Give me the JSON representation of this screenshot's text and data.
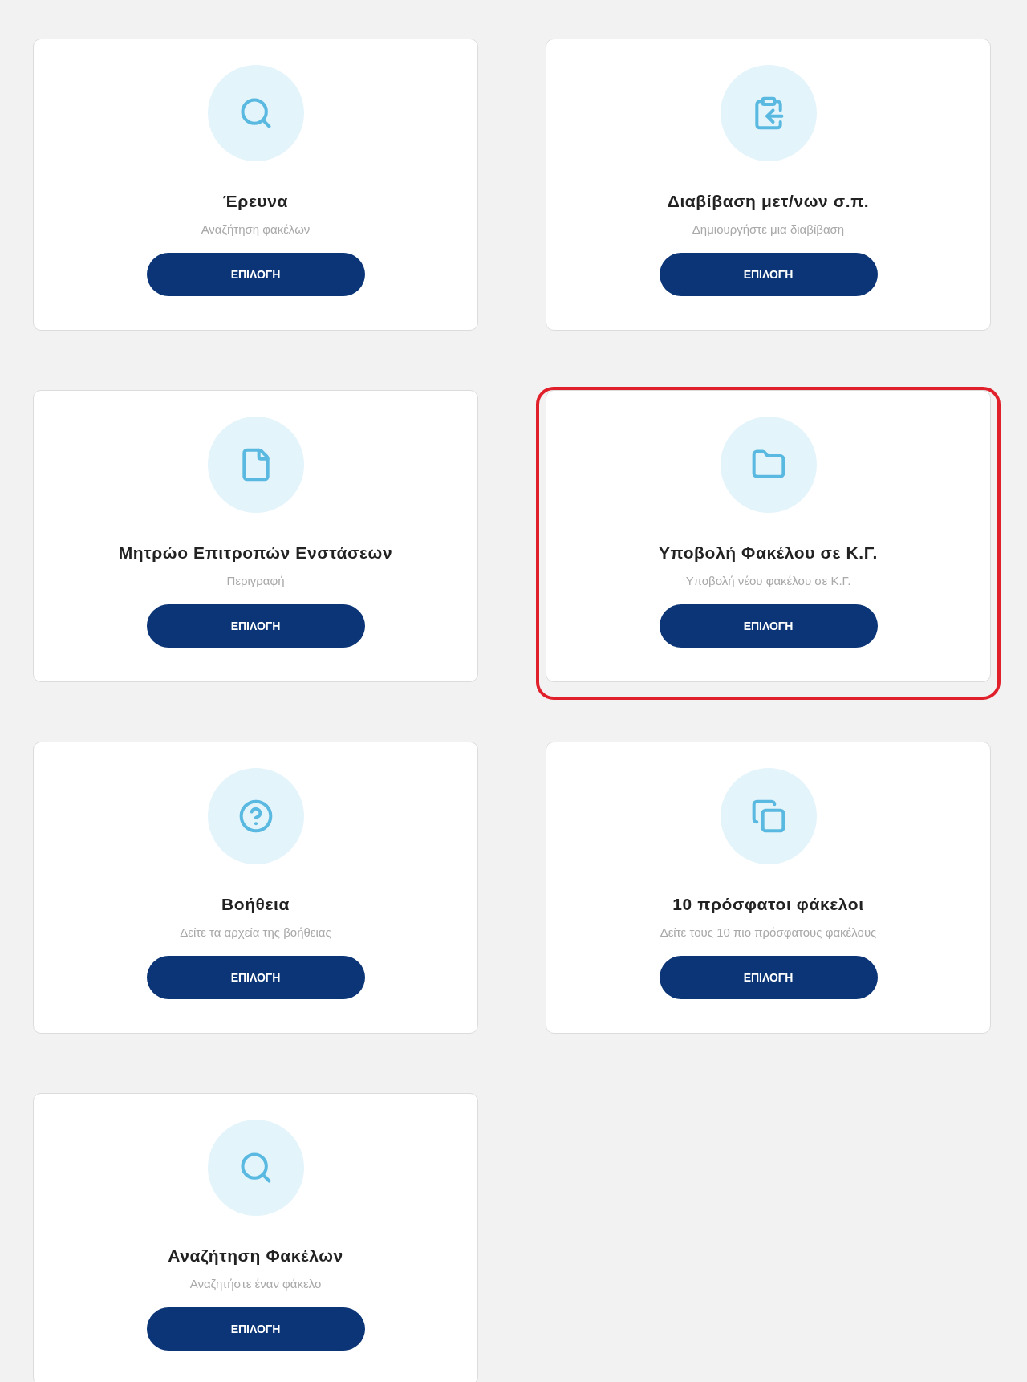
{
  "cards": [
    {
      "kind": "search",
      "title": "Έρευνα",
      "subtitle": "Αναζήτηση φακέλων",
      "button": "ΕΠΙΛΟΓΗ",
      "highlighted": false
    },
    {
      "kind": "clipboard",
      "title": "Διαβίβαση μετ/νων σ.π.",
      "subtitle": "Δημιουργήστε μια διαβίβαση",
      "button": "ΕΠΙΛΟΓΗ",
      "highlighted": false
    },
    {
      "kind": "file",
      "title": "Μητρώο Επιτροπών Ενστάσεων",
      "subtitle": "Περιγραφή",
      "button": "ΕΠΙΛΟΓΗ",
      "highlighted": false
    },
    {
      "kind": "folder",
      "title": "Υποβολή Φακέλου σε Κ.Γ.",
      "subtitle": "Υποβολή νέου φακέλου σε Κ.Γ.",
      "button": "ΕΠΙΛΟΓΗ",
      "highlighted": true
    },
    {
      "kind": "help",
      "title": "Βοήθεια",
      "subtitle": "Δείτε τα αρχεία της βοήθειας",
      "button": "ΕΠΙΛΟΓΗ",
      "highlighted": false
    },
    {
      "kind": "copy",
      "title": "10 πρόσφατοι φάκελοι",
      "subtitle": "Δείτε τους 10 πιο πρόσφατους φακέλους",
      "button": "ΕΠΙΛΟΓΗ",
      "highlighted": false
    },
    {
      "kind": "search",
      "title": "Αναζήτηση Φακέλων",
      "subtitle": "Αναζητήστε έναν φάκελο",
      "button": "ΕΠΙΛΟΓΗ",
      "highlighted": false
    }
  ]
}
